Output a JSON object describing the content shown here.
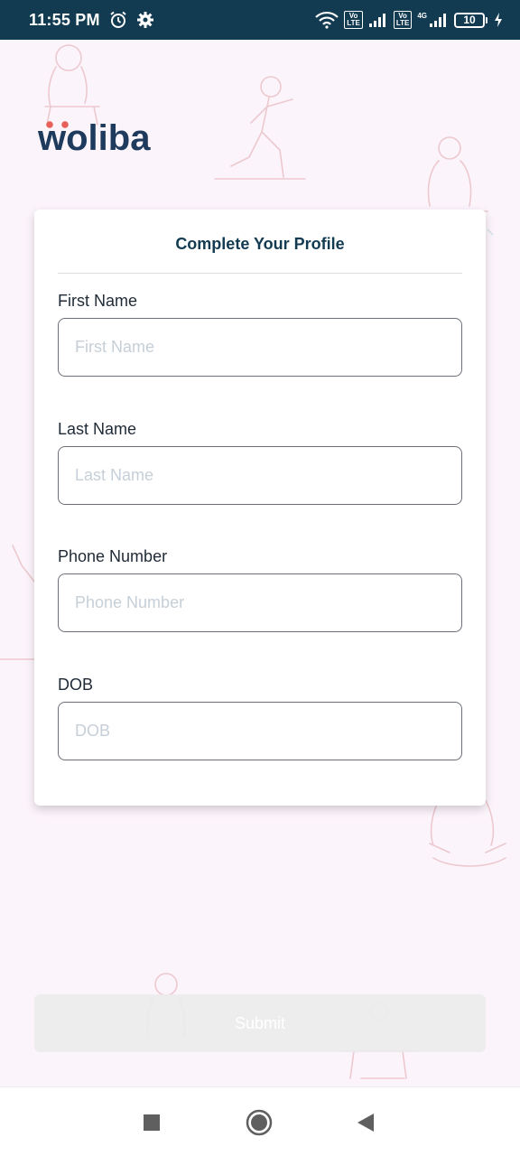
{
  "status_bar": {
    "time": "11:55 PM",
    "icons": [
      "alarm-icon",
      "gear-icon",
      "wifi-icon",
      "volte-icon",
      "signal-icon",
      "volte-icon",
      "4g-signal-icon",
      "battery-icon",
      "charging-icon"
    ],
    "volte_label_top": "Vo",
    "volte_label_bottom": "LTE",
    "network_label": "4G",
    "battery_level": "10"
  },
  "brand": {
    "logo_text": "woliba",
    "accent_color": "#e8605a",
    "primary_color": "#1e3a5c"
  },
  "form": {
    "title": "Complete Your Profile",
    "fields": [
      {
        "label": "First Name",
        "placeholder": "First Name",
        "value": ""
      },
      {
        "label": "Last Name",
        "placeholder": "Last Name",
        "value": ""
      },
      {
        "label": "Phone Number",
        "placeholder": "Phone Number",
        "value": ""
      },
      {
        "label": "DOB",
        "placeholder": "DOB",
        "value": ""
      }
    ]
  },
  "submit": {
    "label": "Submit",
    "enabled": false
  },
  "nav": {
    "buttons": [
      "recents-square-icon",
      "home-circle-icon",
      "back-triangle-icon"
    ]
  }
}
